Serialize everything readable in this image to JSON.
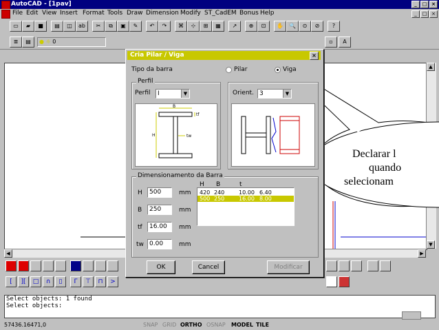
{
  "window": {
    "title": "AutoCAD - [1pav]"
  },
  "menu": [
    "File",
    "Edit",
    "View",
    "Insert",
    "Format",
    "Tools",
    "Draw",
    "Dimension",
    "Modify",
    "ST_CadEM",
    "Bonus",
    "Help"
  ],
  "layer_value": "0",
  "dialog": {
    "title": "Cria Pilar / Viga",
    "tipo_label": "Tipo da barra",
    "radio_pilar": "Pilar",
    "radio_viga": "Viga",
    "perfil_group": "Perfil",
    "perfil_value": "I",
    "orient_group": "Orient.",
    "orient_value": "3",
    "dim_group": "Dimensionamento da Barra",
    "fields": [
      {
        "label": "H",
        "value": "500",
        "unit": "mm"
      },
      {
        "label": "B",
        "value": "250",
        "unit": "mm"
      },
      {
        "label": "tf",
        "value": "16.00",
        "unit": "mm"
      },
      {
        "label": "tw",
        "value": "0.00",
        "unit": "mm"
      }
    ],
    "list_headers": [
      "H",
      "B",
      "t"
    ],
    "list_rows": [
      {
        "h": "420",
        "b": "240",
        "t1": "10.00",
        "t2": "6.40",
        "selected": false
      },
      {
        "h": "500",
        "b": "250",
        "t1": "16.00",
        "t2": "8.00",
        "selected": true
      }
    ],
    "ok": "OK",
    "cancel": "Cancel",
    "modificar": "Modificar",
    "drawing_labels": {
      "b": "B",
      "h": "H",
      "tf": "tf",
      "tw": "tw"
    }
  },
  "callout": {
    "line1": "Declarar l",
    "line2": "quando",
    "line3": "selecionam"
  },
  "command_line": [
    "Select objects: 1 found",
    "Select objects:"
  ],
  "status": {
    "coords": "57436.16471,0",
    "snap": "SNAP",
    "grid": "GRID",
    "ortho": "ORTHO",
    "osnap": "OSNAP",
    "model": "MODEL",
    "tile": "TILE"
  },
  "colors": {
    "title_bg": "#000080",
    "dialog_title": "#c8c800",
    "selection": "#c8c800"
  }
}
